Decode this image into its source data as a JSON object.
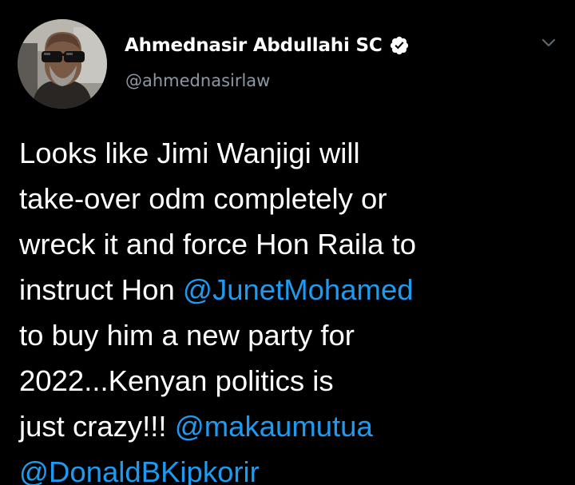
{
  "author": {
    "display_name": "Ahmednasir Abdullahi SC",
    "handle": "@ahmednasirlaw",
    "verified": true,
    "avatar_icon": "profile-photo"
  },
  "menu": {
    "icon": "chevron-down-icon"
  },
  "tweet": {
    "lines": [
      [
        {
          "text": "Looks like Jimi Wanjigi will",
          "mention": false
        }
      ],
      [
        {
          "text": "take-over odm completely or",
          "mention": false
        }
      ],
      [
        {
          "text": "wreck it and force Hon Raila to",
          "mention": false
        }
      ],
      [
        {
          "text": "instruct Hon ",
          "mention": false
        },
        {
          "text": "@JunetMohamed",
          "mention": true
        }
      ],
      [
        {
          "text": "to buy him a new party for",
          "mention": false
        }
      ],
      [
        {
          "text": "2022...Kenyan politics is",
          "mention": false
        }
      ],
      [
        {
          "text": "just crazy!!! ",
          "mention": false
        },
        {
          "text": "@makaumutua",
          "mention": true
        }
      ],
      [
        {
          "text": "@DonaldBKipkorir",
          "mention": true
        }
      ]
    ]
  },
  "colors": {
    "background": "#000000",
    "text": "#ffffff",
    "secondary_text": "#8b98a5",
    "link": "#1d9bf0"
  }
}
